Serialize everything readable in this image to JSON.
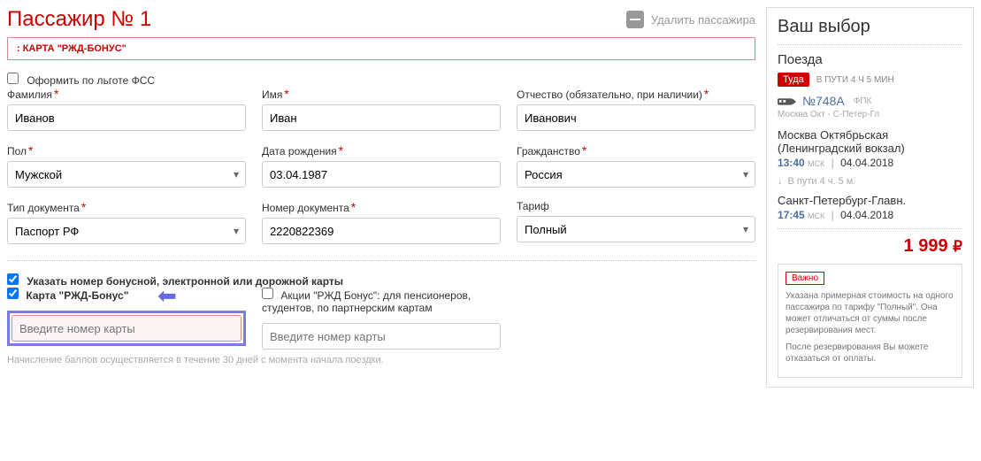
{
  "passenger": {
    "title": "Пассажир № 1",
    "delete_label": "Удалить пассажира",
    "bonus_banner": ": КАРТА \"РЖД-БОНУС\"",
    "fss_label": "Оформить по льготе ФСС",
    "labels": {
      "surname": "Фамилия",
      "name": "Имя",
      "patronymic": "Отчество (обязательно, при наличии)",
      "gender": "Пол",
      "dob": "Дата рождения",
      "citizenship": "Гражданство",
      "doctype": "Тип документа",
      "docnum": "Номер документа",
      "tariff": "Тариф"
    },
    "values": {
      "surname": "Иванов",
      "name": "Иван",
      "patronymic": "Иванович",
      "gender": "Мужской",
      "dob": "03.04.1987",
      "citizenship": "Россия",
      "doctype": "Паспорт РФ",
      "docnum": "2220822369",
      "tariff": "Полный"
    },
    "bonus_section": {
      "specify_label": "Указать номер бонусной, электронной или дорожной карты",
      "rzd_bonus_label": "Карта \"РЖД-Бонус\"",
      "pension_label": "Акции \"РЖД Бонус\": для пенсионеров, студентов, по партнерским картам",
      "card_placeholder": "Введите номер карты",
      "note": "Начисление баллов осуществляется в течение 30 дней с момента начала поездки."
    }
  },
  "sidebar": {
    "title": "Ваш выбор",
    "trains": "Поезда",
    "tuda": "Туда",
    "travel_time_top": "В ПУТИ 4 ч 5 МИН",
    "train_num": "№748А",
    "train_type": "ФПК",
    "route_small": "Москва Окт - С-Петер-Гл",
    "dep_station": "Москва Октябрьская (Ленинградский вокзал)",
    "dep_time": "13:40",
    "dep_date": "04.04.2018",
    "inway": "В пути  4 ч. 5 м.",
    "arr_station": "Санкт-Петербург-Главн.",
    "arr_time": "17:45",
    "arr_date": "04.04.2018",
    "msk": "МСК",
    "price": "1 999",
    "rub": "₽",
    "info_badge": "Важно",
    "info_p1": "Указана примерная стоимость на одного пассажира по тарифу \"Полный\". Она может отличаться от суммы после резервирования мест.",
    "info_p2": "После резервирования Вы можете отказаться от оплаты."
  }
}
